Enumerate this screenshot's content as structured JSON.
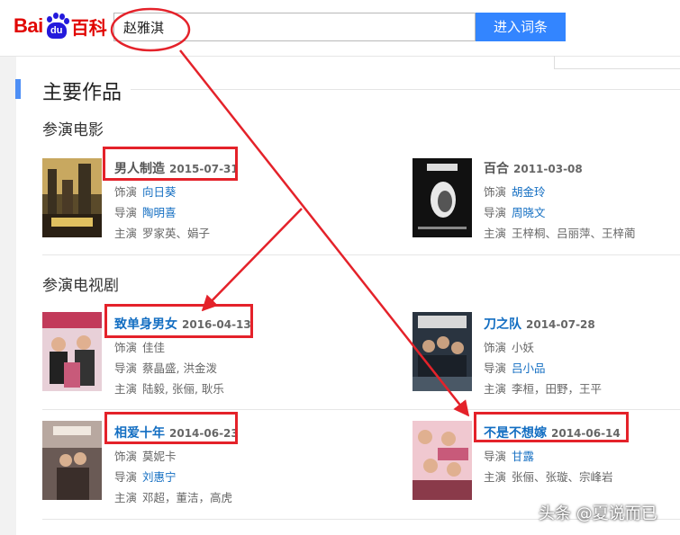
{
  "logo": {
    "bai": "Bai",
    "du": "du",
    "baike": "百科"
  },
  "search": {
    "value": "赵雅淇",
    "button_label": "进入词条"
  },
  "section": {
    "title": "主要作品"
  },
  "categories": {
    "films": "参演电影",
    "tv": "参演电视剧"
  },
  "labels": {
    "role": "饰演",
    "director": "导演",
    "cast": "主演"
  },
  "works": [
    {
      "title": "男人制造",
      "date": "2015-07-31",
      "role": "向日葵",
      "director": "陶明喜",
      "cast": "罗家英、娟子",
      "poster_color": "#7a6a3a"
    },
    {
      "title": "百合",
      "date": "2011-03-08",
      "role": "胡金玲",
      "director": "周晓文",
      "cast": "王梓桐、吕丽萍、王梓蔺",
      "poster_color": "#1a1a1a"
    },
    {
      "title": "致单身男女",
      "date": "2016-04-13",
      "role": "佳佳",
      "director": "蔡晶盛, 洪金泼",
      "cast": "陆毅, 张俪, 耿乐",
      "poster_color": "#c23a5a"
    },
    {
      "title": "刀之队",
      "date": "2014-07-28",
      "role": "小妖",
      "director": "吕小品",
      "cast": "李桓，田野，王平",
      "poster_color": "#3a4a5a"
    },
    {
      "title": "相爱十年",
      "date": "2014-06-23",
      "role": "莫妮卡",
      "director": "刘惠宁",
      "cast": "邓超，董洁，高虎",
      "poster_color": "#8a6a5a"
    },
    {
      "title": "不是不想嫁",
      "date": "2014-06-14",
      "director": "甘露",
      "cast": "张俪、张璇、宗峰岩",
      "poster_color": "#c85a7a"
    }
  ],
  "watermark": "头条 @夏说而已"
}
